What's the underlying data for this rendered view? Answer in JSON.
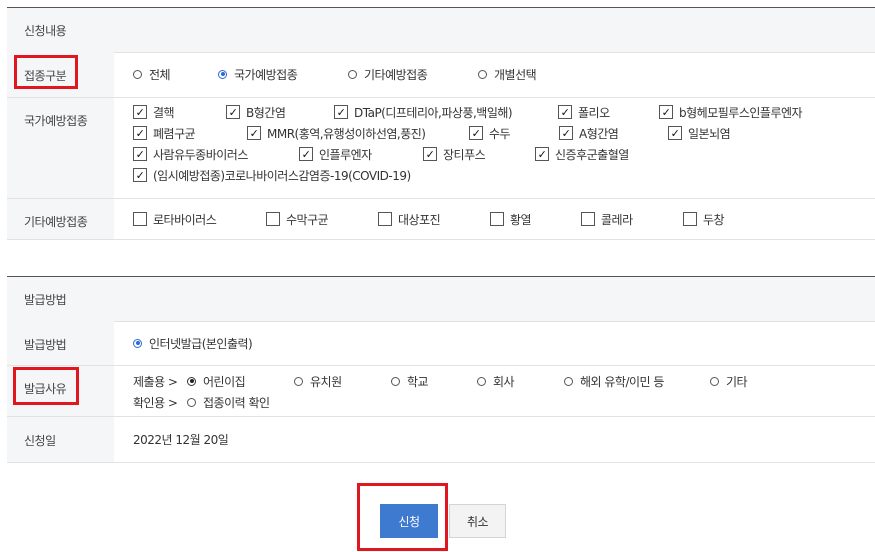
{
  "section1": {
    "title": "신청내용",
    "category": {
      "label": "접종구분",
      "options": [
        "전체",
        "국가예방접종",
        "기타예방접종",
        "개별선택"
      ],
      "selected": "국가예방접종"
    },
    "national": {
      "label": "국가예방접종",
      "items": [
        {
          "text": "결핵",
          "checked": true
        },
        {
          "text": "B형간염",
          "checked": true
        },
        {
          "text": "DTaP(디프테리아,파상풍,백일해)",
          "checked": true
        },
        {
          "text": "폴리오",
          "checked": true
        },
        {
          "text": "b형헤모필루스인플루엔자",
          "checked": true
        },
        {
          "text": "폐렴구균",
          "checked": true
        },
        {
          "text": "MMR(홍역,유행성이하선염,풍진)",
          "checked": true
        },
        {
          "text": "수두",
          "checked": true
        },
        {
          "text": "A형간염",
          "checked": true
        },
        {
          "text": "일본뇌염",
          "checked": true
        },
        {
          "text": "사람유두종바이러스",
          "checked": true
        },
        {
          "text": "인플루엔자",
          "checked": true
        },
        {
          "text": "장티푸스",
          "checked": true
        },
        {
          "text": "신증후군출혈열",
          "checked": true
        },
        {
          "text": "(임시예방접종)코로나바이러스감염증-19(COVID-19)",
          "checked": true
        }
      ]
    },
    "other": {
      "label": "기타예방접종",
      "items": [
        {
          "text": "로타바이러스",
          "checked": false
        },
        {
          "text": "수막구균",
          "checked": false
        },
        {
          "text": "대상포진",
          "checked": false
        },
        {
          "text": "황열",
          "checked": false
        },
        {
          "text": "콜레라",
          "checked": false
        },
        {
          "text": "두창",
          "checked": false
        }
      ]
    }
  },
  "section2": {
    "title": "발급방법",
    "method": {
      "label": "발급방법",
      "option": "인터넷발급(본인출력)"
    },
    "reason": {
      "label": "발급사유",
      "submit_prefix": "제출용 >",
      "submit_options": [
        "어린이집",
        "유치원",
        "학교",
        "회사",
        "해외 유학/이민 등",
        "기타"
      ],
      "selected": "어린이집",
      "confirm_prefix": "확인용 >",
      "confirm_option": "접종이력 확인"
    },
    "date": {
      "label": "신청일",
      "value": "2022년 12월 20일"
    }
  },
  "buttons": {
    "apply": "신청",
    "cancel": "취소"
  },
  "colors": {
    "accent": "#3f7ad1",
    "highlight": "#e0171f"
  }
}
